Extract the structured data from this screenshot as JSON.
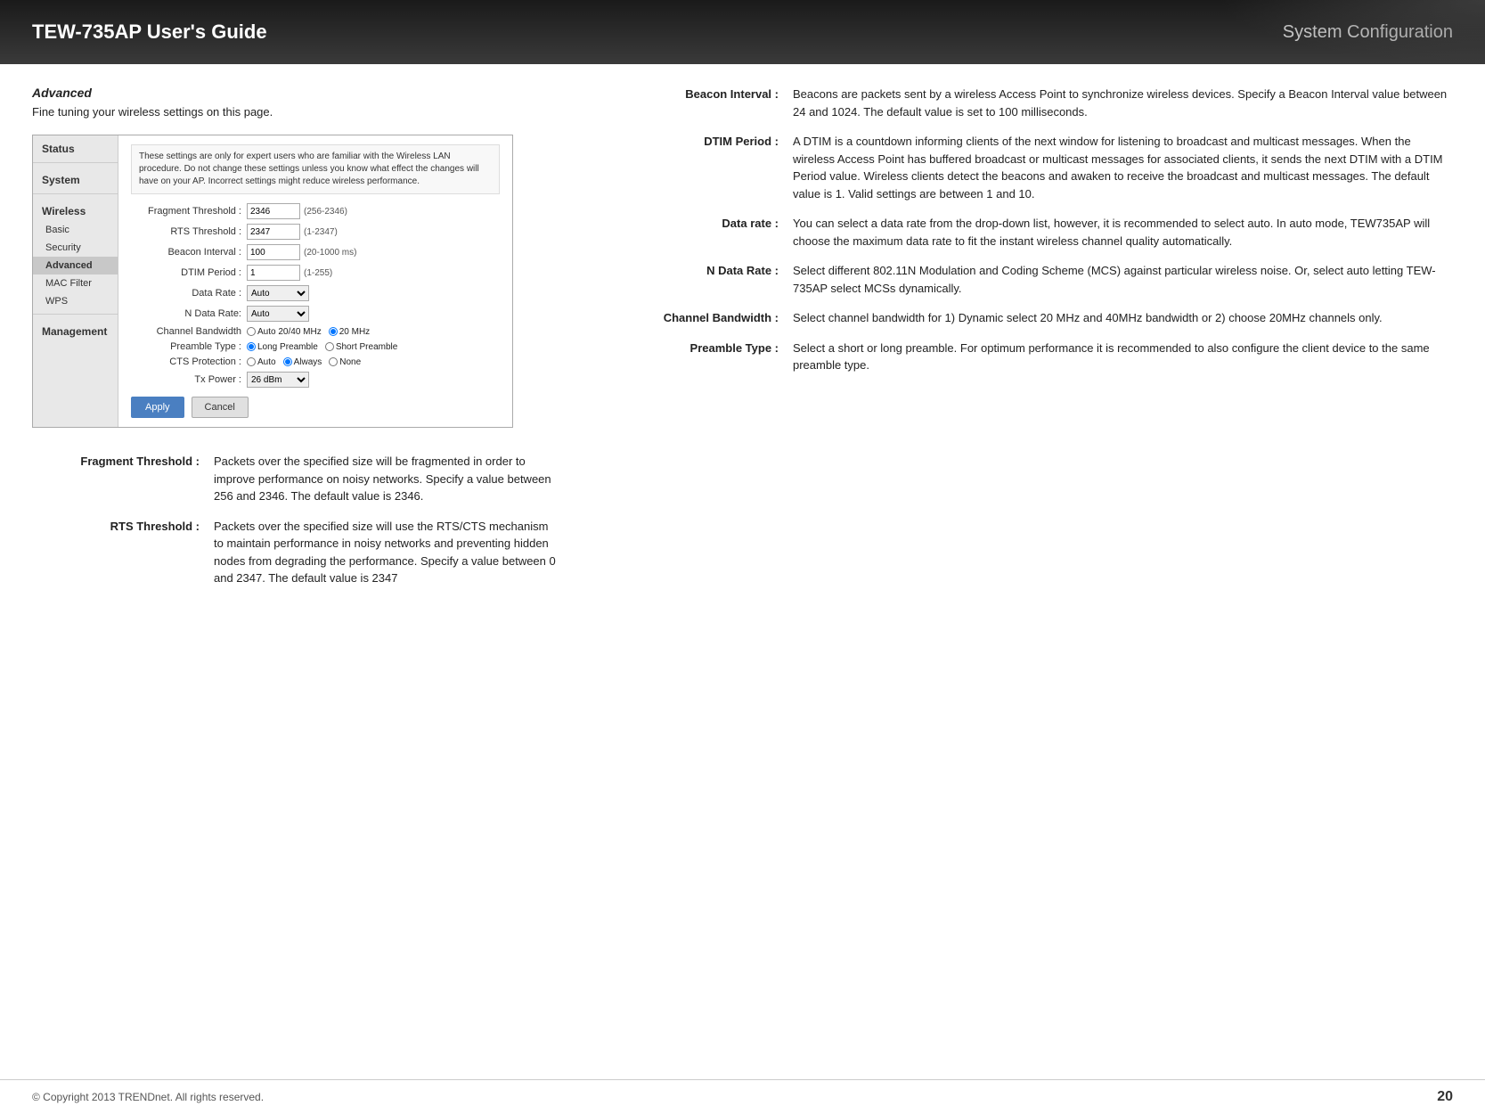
{
  "header": {
    "title": "TEW-735AP User's Guide",
    "right": "System Configuration"
  },
  "page": {
    "section_title": "Advanced",
    "section_subtitle": "Fine tuning your wireless settings on this page."
  },
  "router_ui": {
    "warning": "These settings are only for expert users who are familiar with the Wireless LAN procedure. Do not change these settings unless you know what effect the changes will have on your AP. Incorrect settings might reduce wireless performance.",
    "sidebar": {
      "sections": [
        {
          "label": "Status",
          "type": "section"
        },
        {
          "label": "System",
          "type": "section"
        },
        {
          "label": "Wireless",
          "type": "section"
        },
        {
          "label": "Basic",
          "type": "item"
        },
        {
          "label": "Security",
          "type": "item"
        },
        {
          "label": "Advanced",
          "type": "item",
          "active": true
        },
        {
          "label": "MAC Filter",
          "type": "item"
        },
        {
          "label": "WPS",
          "type": "item"
        },
        {
          "label": "Management",
          "type": "section"
        }
      ]
    },
    "form": {
      "fragment_threshold": {
        "label": "Fragment Threshold :",
        "value": "2346",
        "hint": "(256-2346)"
      },
      "rts_threshold": {
        "label": "RTS Threshold :",
        "value": "2347",
        "hint": "(1-2347)"
      },
      "beacon_interval": {
        "label": "Beacon Interval :",
        "value": "100",
        "hint": "(20-1000 ms)"
      },
      "dtim_period": {
        "label": "DTIM Period :",
        "value": "1",
        "hint": "(1-255)"
      },
      "data_rate": {
        "label": "Data Rate :",
        "value": "Auto"
      },
      "n_data_rate": {
        "label": "N Data Rate:",
        "value": "Auto"
      },
      "channel_bandwidth": {
        "label": "Channel Bandwidth",
        "options": [
          {
            "label": "Auto 20/40 MHz",
            "value": "auto"
          },
          {
            "label": "20 MHz",
            "value": "20",
            "checked": true
          }
        ]
      },
      "preamble_type": {
        "label": "Preamble Type :",
        "options": [
          {
            "label": "Long Preamble",
            "value": "long",
            "checked": true
          },
          {
            "label": "Short Preamble",
            "value": "short"
          }
        ]
      },
      "cts_protection": {
        "label": "CTS Protection :",
        "options": [
          {
            "label": "Auto",
            "value": "auto"
          },
          {
            "label": "Always",
            "value": "always",
            "checked": true
          },
          {
            "label": "None",
            "value": "none"
          }
        ]
      },
      "tx_power": {
        "label": "Tx Power :",
        "value": "26 dBm"
      },
      "apply_btn": "Apply",
      "cancel_btn": "Cancel"
    }
  },
  "descriptions_left": [
    {
      "label": "Fragment Threshold :",
      "text": "Packets over the specified size will be fragmented in order to improve performance on noisy networks. Specify a value between 256 and 2346. The default value is 2346."
    },
    {
      "label": "RTS Threshold :",
      "text": "Packets over the specified size will use the RTS/CTS mechanism to maintain performance in noisy networks and preventing hidden nodes from degrading the performance. Specify a value between 0 and 2347. The default value is 2347"
    }
  ],
  "descriptions_right": [
    {
      "label": "Beacon Interval :",
      "text": "Beacons are packets sent by a wireless Access Point to synchronize wireless devices. Specify a Beacon Interval value between 24 and 1024. The default value is set to 100 milliseconds."
    },
    {
      "label": "DTIM Period :",
      "text": "A DTIM is a countdown informing clients of the next window for listening to broadcast and multicast messages. When the wireless Access Point has buffered broadcast or multicast messages for associated clients, it sends the next DTIM with a DTIM Period value. Wireless clients detect the beacons and awaken to receive the broadcast and multicast messages. The default value is 1. Valid settings are between 1 and 10."
    },
    {
      "label": "Data rate :",
      "text": "You can select a data rate from the drop-down list, however, it is recommended to select auto. In auto mode, TEW735AP will choose the maximum data rate to fit the instant wireless channel quality automatically."
    },
    {
      "label": "N Data Rate :",
      "text": "Select different 802.11N Modulation and Coding Scheme (MCS) against particular wireless noise. Or,  select auto letting TEW-735AP select MCSs dynamically."
    },
    {
      "label": "Channel Bandwidth :",
      "text": "Select channel bandwidth for 1) Dynamic select 20 MHz and 40MHz bandwidth or 2) choose 20MHz channels only."
    },
    {
      "label": "Preamble Type :",
      "text": "Select a short or long preamble. For optimum performance it is recommended to also configure the client device to the same preamble type."
    }
  ],
  "footer": {
    "copyright": "© Copyright 2013 TRENDnet.  All rights reserved.",
    "page_number": "20"
  }
}
